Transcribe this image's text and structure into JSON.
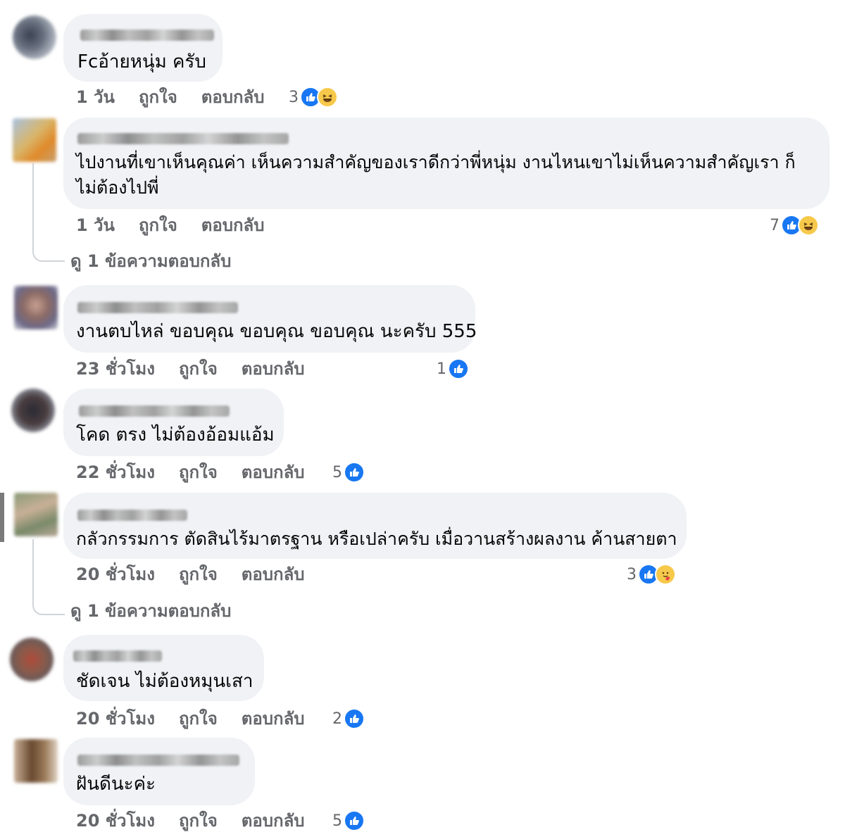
{
  "comments": [
    {
      "text": "Fcอ้ายหนุ่ม ครับ",
      "time": "1 วัน",
      "like": "ถูกใจ",
      "reply": "ตอบกลับ",
      "reaction_count": "3",
      "reactions": [
        "like-icon",
        "haha-icon"
      ]
    },
    {
      "text_line1": "ไปงานที่เขาเห็นคุณค่า เห็นความสำคัญของเราดีกว่าพี่หนุ่ม งานไหนเขาไม่เห็นความสำคัญเรา ก็",
      "text_line2": "ไม่ต้องไปพี่",
      "time": "1 วัน",
      "like": "ถูกใจ",
      "reply": "ตอบกลับ",
      "reaction_count": "7",
      "reactions": [
        "like-icon",
        "haha-icon"
      ],
      "view_replies": "ดู 1 ข้อความตอบกลับ"
    },
    {
      "text": "งานตบไหล่ ขอบคุณ ขอบคุณ ขอบคุณ นะครับ 555",
      "time": "23 ชั่วโมง",
      "like": "ถูกใจ",
      "reply": "ตอบกลับ",
      "reaction_count": "1",
      "reactions": [
        "like-icon"
      ]
    },
    {
      "text": "โคด ตรง ไม่ต้องอ้อมแอ้ม",
      "time": "22 ชั่วโมง",
      "like": "ถูกใจ",
      "reply": "ตอบกลับ",
      "reaction_count": "5",
      "reactions": [
        "like-icon"
      ]
    },
    {
      "text": "กลัวกรรมการ ตัดสินไร้มาตรฐาน หรือเปล่าครับ เมื่อวานสร้างผลงาน ค้านสายตา",
      "time": "20 ชั่วโมง",
      "like": "ถูกใจ",
      "reply": "ตอบกลับ",
      "reaction_count": "3",
      "reactions": [
        "like-icon",
        "care-icon"
      ],
      "view_replies": "ดู 1 ข้อความตอบกลับ"
    },
    {
      "text": "ชัดเจน ไม่ต้องหมุนเสา",
      "time": "20 ชั่วโมง",
      "like": "ถูกใจ",
      "reply": "ตอบกลับ",
      "reaction_count": "2",
      "reactions": [
        "like-icon"
      ]
    },
    {
      "text": "ฝันดีนะค่ะ",
      "time": "20 ชั่วโมง",
      "like": "ถูกใจ",
      "reply": "ตอบกลับ",
      "reaction_count": "5",
      "reactions": [
        "like-icon"
      ]
    }
  ],
  "colors": {
    "bubble": "#f0f2f5",
    "meta_text": "#65676b",
    "like_blue": "#1877f2",
    "haha_yellow": "#f7c94b"
  }
}
